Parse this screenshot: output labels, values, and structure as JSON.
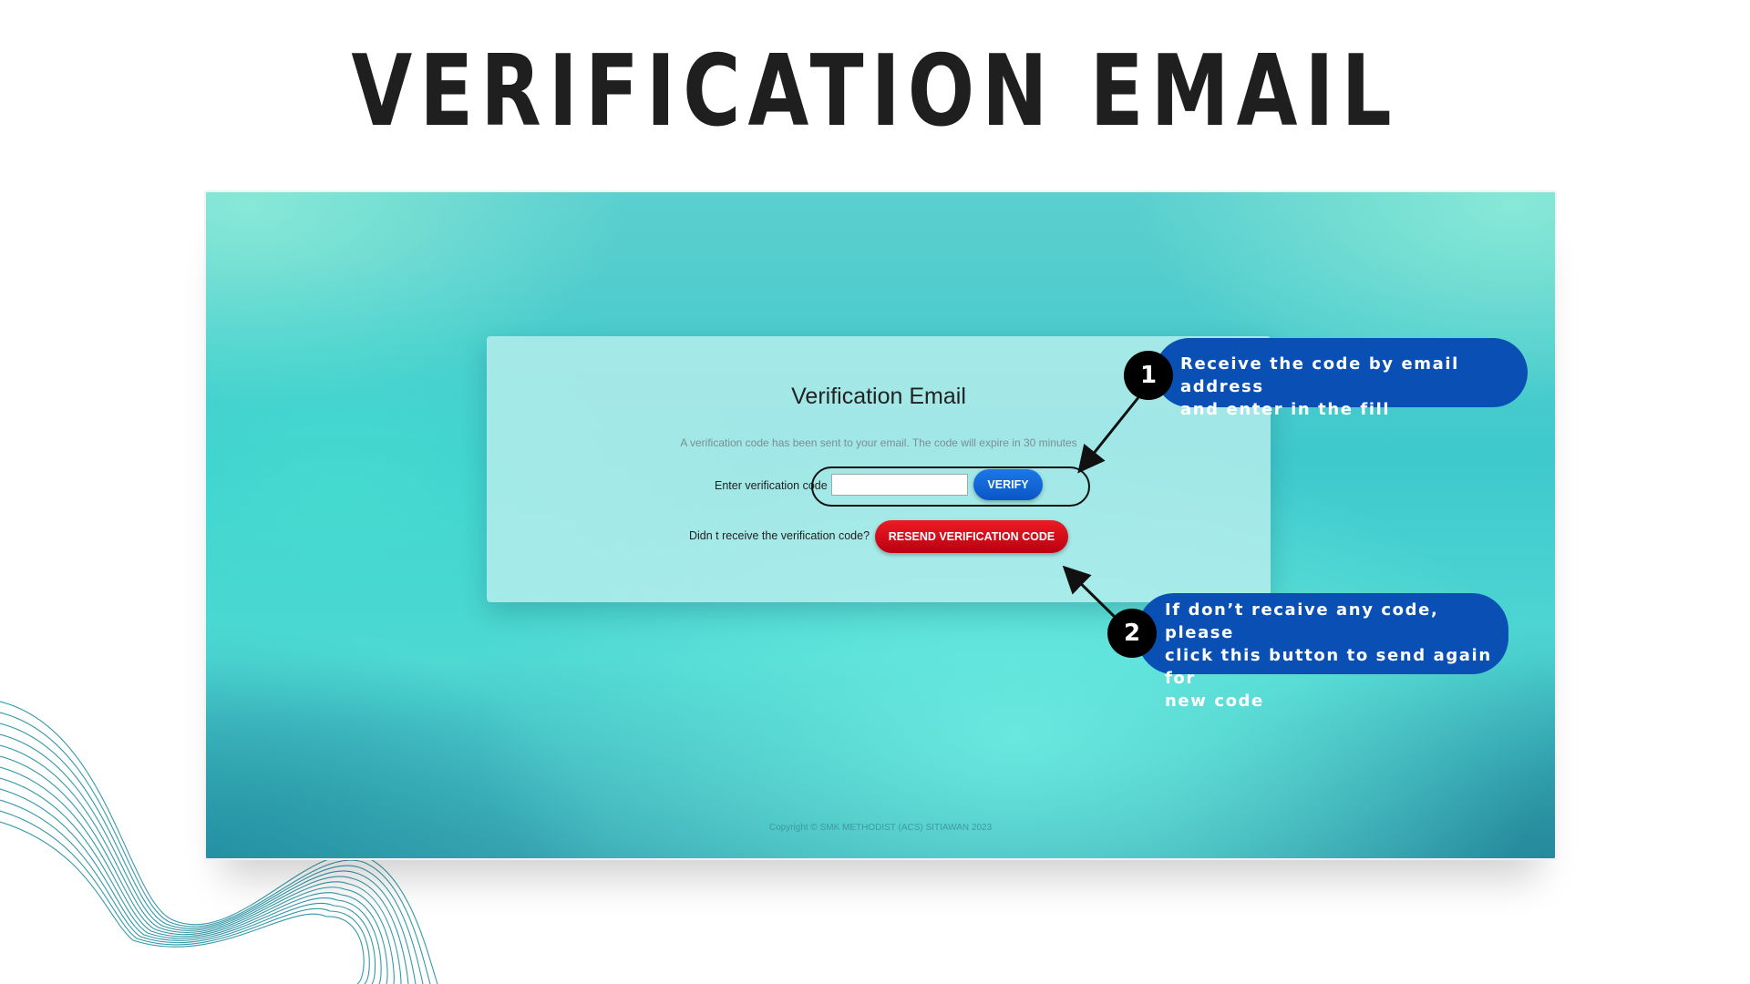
{
  "slide": {
    "title": "VERIFICATION EMAIL"
  },
  "page": {
    "title": "Verification Email",
    "description": "A verification code has been sent to your email. The code will expire in 30 minutes",
    "code_label": "Enter verification code",
    "code_value": "",
    "verify_label": "VERIFY",
    "resend_prompt": "Didn t receive the verification code?",
    "resend_label": "RESEND VERIFICATION CODE",
    "copyright": "Copyright © SMK METHODIST (ACS) SITIAWAN 2023"
  },
  "callouts": [
    {
      "number": "1",
      "lines": [
        "Receive the code by email address",
        "and enter in the fill"
      ]
    },
    {
      "number": "2",
      "lines": [
        "If don’t recaive any code, please",
        "click this button to send again for",
        "new code"
      ]
    }
  ],
  "colors": {
    "verify_button": "#0a55c8",
    "resend_button": "#d4001a",
    "callout_bg": "#0a50b4",
    "background_teal": "#3ec9cc"
  }
}
